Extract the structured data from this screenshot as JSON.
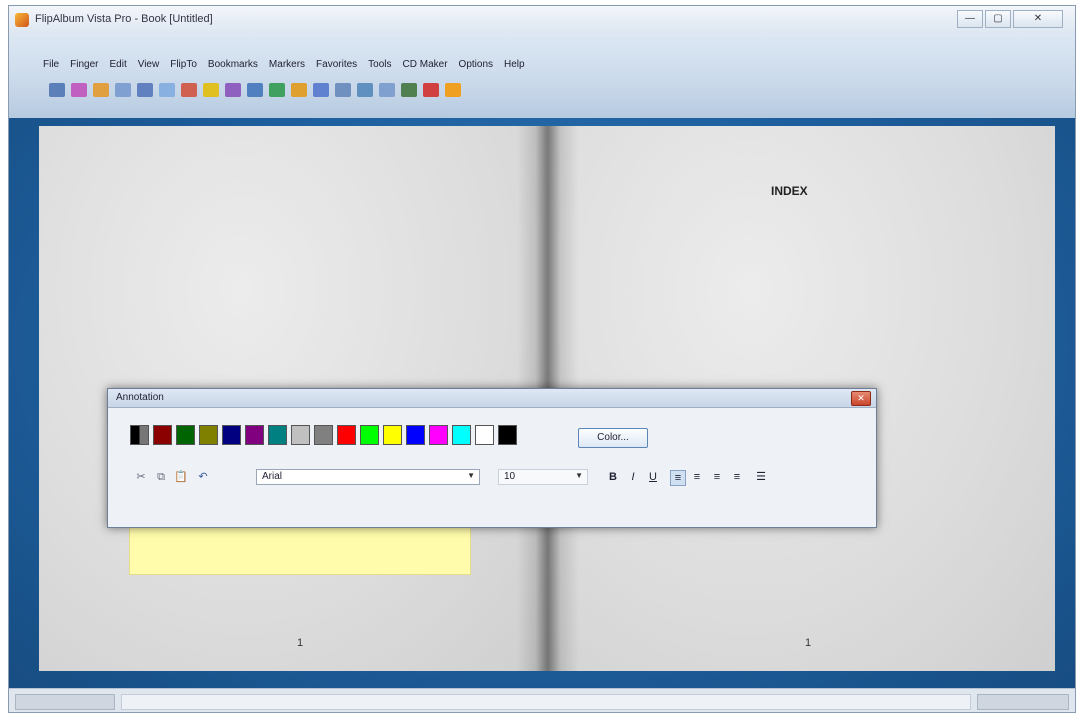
{
  "window": {
    "title": "FlipAlbum Vista Pro - Book [Untitled]",
    "controls": {
      "minimize": "—",
      "maximize": "▢",
      "close": "✕"
    }
  },
  "menu": {
    "items": [
      "File",
      "Finger",
      "Edit",
      "View",
      "FlipTo",
      "Bookmarks",
      "Markers",
      "Favorites",
      "Tools",
      "CD Maker",
      "Options",
      "Help"
    ]
  },
  "toolbar": {
    "icons": [
      "book-icon",
      "tag-icon",
      "album-icon",
      "arrow-left-icon",
      "arrow-right-icon",
      "pages-icon",
      "photo-icon",
      "eye-icon",
      "brush-icon",
      "cursor-icon",
      "tree-icon",
      "frame-icon",
      "info-icon",
      "layout-icon",
      "chart-icon",
      "crop-icon",
      "monitor-icon",
      "pen-icon",
      "star-icon"
    ],
    "colors": [
      "#5b7fb8",
      "#c060c0",
      "#e0a040",
      "#7fa0d0",
      "#6080c0",
      "#88b0e0",
      "#d06050",
      "#e0c020",
      "#9060c0",
      "#5080c0",
      "#40a060",
      "#e0a030",
      "#6080d0",
      "#7090c0",
      "#6090c0",
      "#80a0d0",
      "#508050",
      "#d04040",
      "#f0a020"
    ]
  },
  "book": {
    "right_page_heading": "INDEX",
    "left_page_number": "1",
    "right_page_number": "1"
  },
  "annotation": {
    "title": "Annotation",
    "palette": [
      "#000000",
      "#8b0000",
      "#006400",
      "#808000",
      "#000080",
      "#800080",
      "#008080",
      "#c0c0c0",
      "#808080",
      "#ff0000",
      "#00ff00",
      "#ffff00",
      "#0000ff",
      "#ff00ff",
      "#00ffff",
      "#ffffff",
      "#000000"
    ],
    "color_button": "Color...",
    "font_value": "Arial",
    "size_value": "10"
  },
  "note": {
    "color": "#fffcab"
  }
}
